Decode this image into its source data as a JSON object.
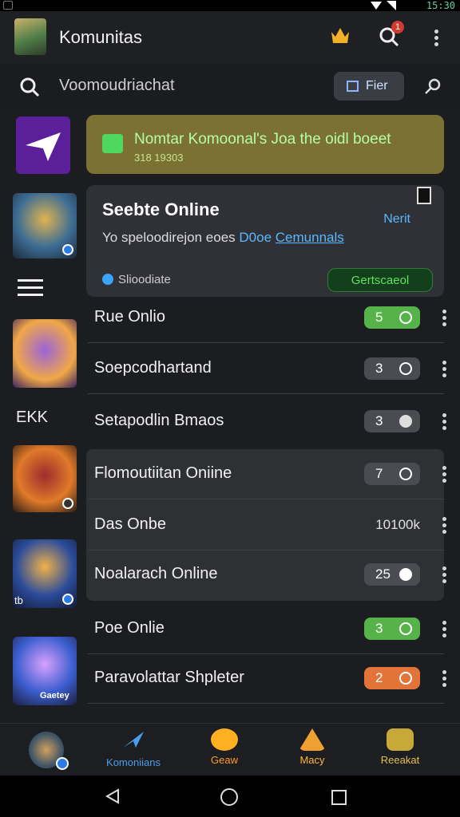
{
  "status": {
    "time": "15:30"
  },
  "appbar": {
    "title": "Komunitas",
    "notification_count": "1"
  },
  "search": {
    "text": "Voomoudriachat",
    "filter_label": "Fier"
  },
  "sidebar": {
    "label": "EKK",
    "game4_label": "tb",
    "game5_label": "Gaetey"
  },
  "notice": {
    "title": "Nomtar Komoonal's Joa the oidl boeet",
    "subtitle": "318 19303"
  },
  "card": {
    "title": "Seebte Online",
    "next": "Nerit",
    "body_prefix": "Yo speloodirejon eoes ",
    "body_link_1": "D0oe",
    "body_link_2": "Cemunnals",
    "footer": "Slioodiate",
    "button": "Gertscaeol"
  },
  "rows": [
    {
      "name": "Rue Onlio",
      "count": "5",
      "style": "green"
    },
    {
      "name": "Soepcodhartand",
      "count": "3",
      "style": "gray"
    },
    {
      "name": "Setapodlin Bmaos",
      "count": "3",
      "style": "gray"
    },
    {
      "name": "Flomoutiitan Oniine",
      "count": "7",
      "style": "gray"
    },
    {
      "name": "Das Onbe",
      "value": "10100k",
      "style": "plain"
    },
    {
      "name": "Noalarach Online",
      "count": "25",
      "style": "gray"
    },
    {
      "name": "Poe Onlie",
      "count": "3",
      "style": "green"
    },
    {
      "name": "Paravolattar Shpleter",
      "count": "2",
      "style": "orange"
    }
  ],
  "bottomnav": [
    {
      "label": "Komoniians",
      "color": "#4a9de8"
    },
    {
      "label": "Geaw",
      "color": "#ff9a2e"
    },
    {
      "label": "Macy",
      "color": "#ffb43a"
    },
    {
      "label": "Reeakat",
      "color": "#e0c050"
    }
  ],
  "colors": {
    "accent": "#4a9de8",
    "green": "#55b34a",
    "orange": "#e2743a",
    "background": "#1c1d20"
  }
}
